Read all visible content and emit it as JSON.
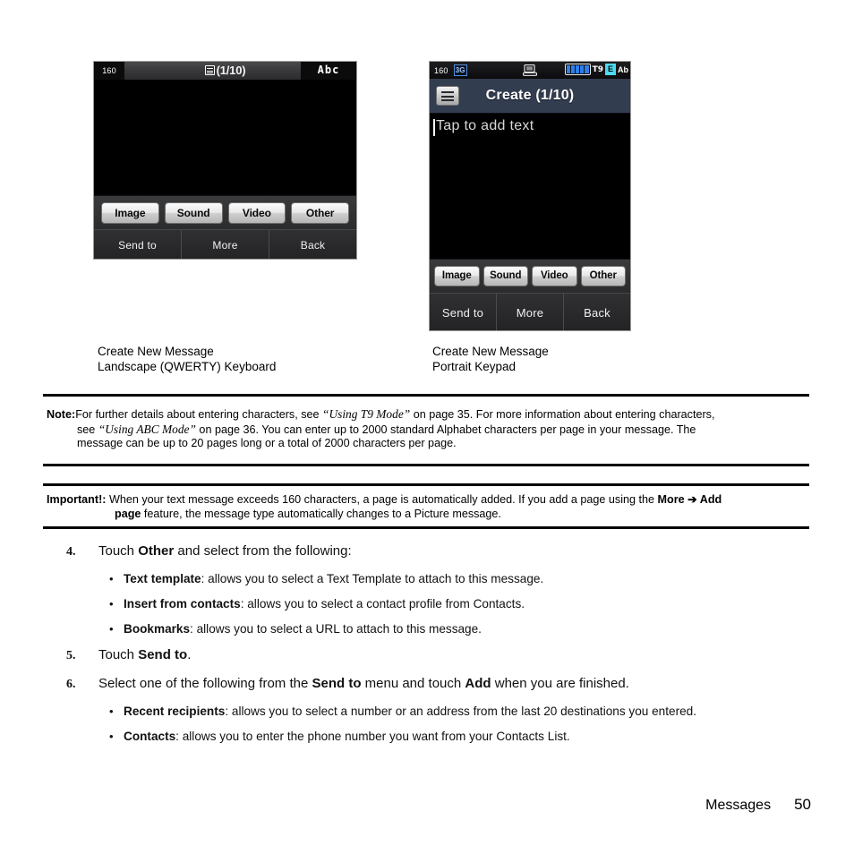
{
  "figures": {
    "landscape": {
      "status": {
        "char_count": "160",
        "title": "(1/10)",
        "message_icon": "message-lines-icon",
        "input_mode": "Abc"
      },
      "attachments": [
        "Image",
        "Sound",
        "Video",
        "Other"
      ],
      "softkeys": [
        "Send to",
        "More",
        "Back"
      ]
    },
    "portrait": {
      "status": {
        "char_count": "160",
        "network": "3G",
        "pc_icon": "pc-sync-icon",
        "battery_icon": "battery-full-icon",
        "t9": "T9",
        "e_badge": "E",
        "ab_badge": "Ab"
      },
      "title": "Create (1/10)",
      "menu_icon": "menu-list-icon",
      "body_placeholder": "Tap to add text",
      "attachments": [
        "Image",
        "Sound",
        "Video",
        "Other"
      ],
      "softkeys": [
        "Send to",
        "More",
        "Back"
      ]
    },
    "captions": {
      "left_line1": "Create New Message",
      "left_line2": "Landscape (QWERTY) Keyboard",
      "right_line1": "Create New Message",
      "right_line2": "Portrait Keypad"
    }
  },
  "note": {
    "label": "Note:",
    "line1_a": "For further details about entering characters, see ",
    "line1_ital": "“Using T9 Mode”",
    "line1_b": " on page 35. For more information about entering characters,",
    "line2_a": "see ",
    "line2_ital": "“Using ABC Mode”",
    "line2_b": " on page 36. You can enter up to 2000 standard Alphabet characters per page in your message. The",
    "line3": "message can be up to 20 pages long or a total of 2000 characters per page."
  },
  "important": {
    "label": "Important!:",
    "line1_a": "When your text message exceeds 160 characters, a page is automatically added. If you add a page using the ",
    "line1_bold1": "More",
    "line1_arrow": " ➔ ",
    "line1_bold2": "Add",
    "line2_bold": "page",
    "line2_rest": " feature, the message type automatically changes to a Picture message."
  },
  "steps": [
    {
      "num": "4.",
      "text_a": "Touch ",
      "bold": "Other",
      "text_b": " and select from the following:",
      "bullets": [
        {
          "term": "Text template",
          "desc": ": allows you to select a Text Template to attach to this message."
        },
        {
          "term": "Insert from contacts",
          "desc": ": allows you to select a contact profile from Contacts."
        },
        {
          "term": "Bookmarks",
          "desc": ": allows you to select a URL to attach to this message."
        }
      ]
    },
    {
      "num": "5.",
      "text_a": "Touch ",
      "bold": "Send to",
      "text_b": ".",
      "bullets": []
    },
    {
      "num": "6.",
      "text_a": "Select one of the following from the ",
      "bold": "Send to",
      "text_mid": " menu and touch ",
      "bold2": "Add",
      "text_b": " when you are finished.",
      "bullets": [
        {
          "term": "Recent recipients",
          "desc": ": allows you to select a number or an address from the last 20 destinations you entered."
        },
        {
          "term": "Contacts",
          "desc": ": allows you to enter the phone number you want from your Contacts List."
        }
      ]
    }
  ],
  "footer": {
    "section": "Messages",
    "page": "50"
  }
}
